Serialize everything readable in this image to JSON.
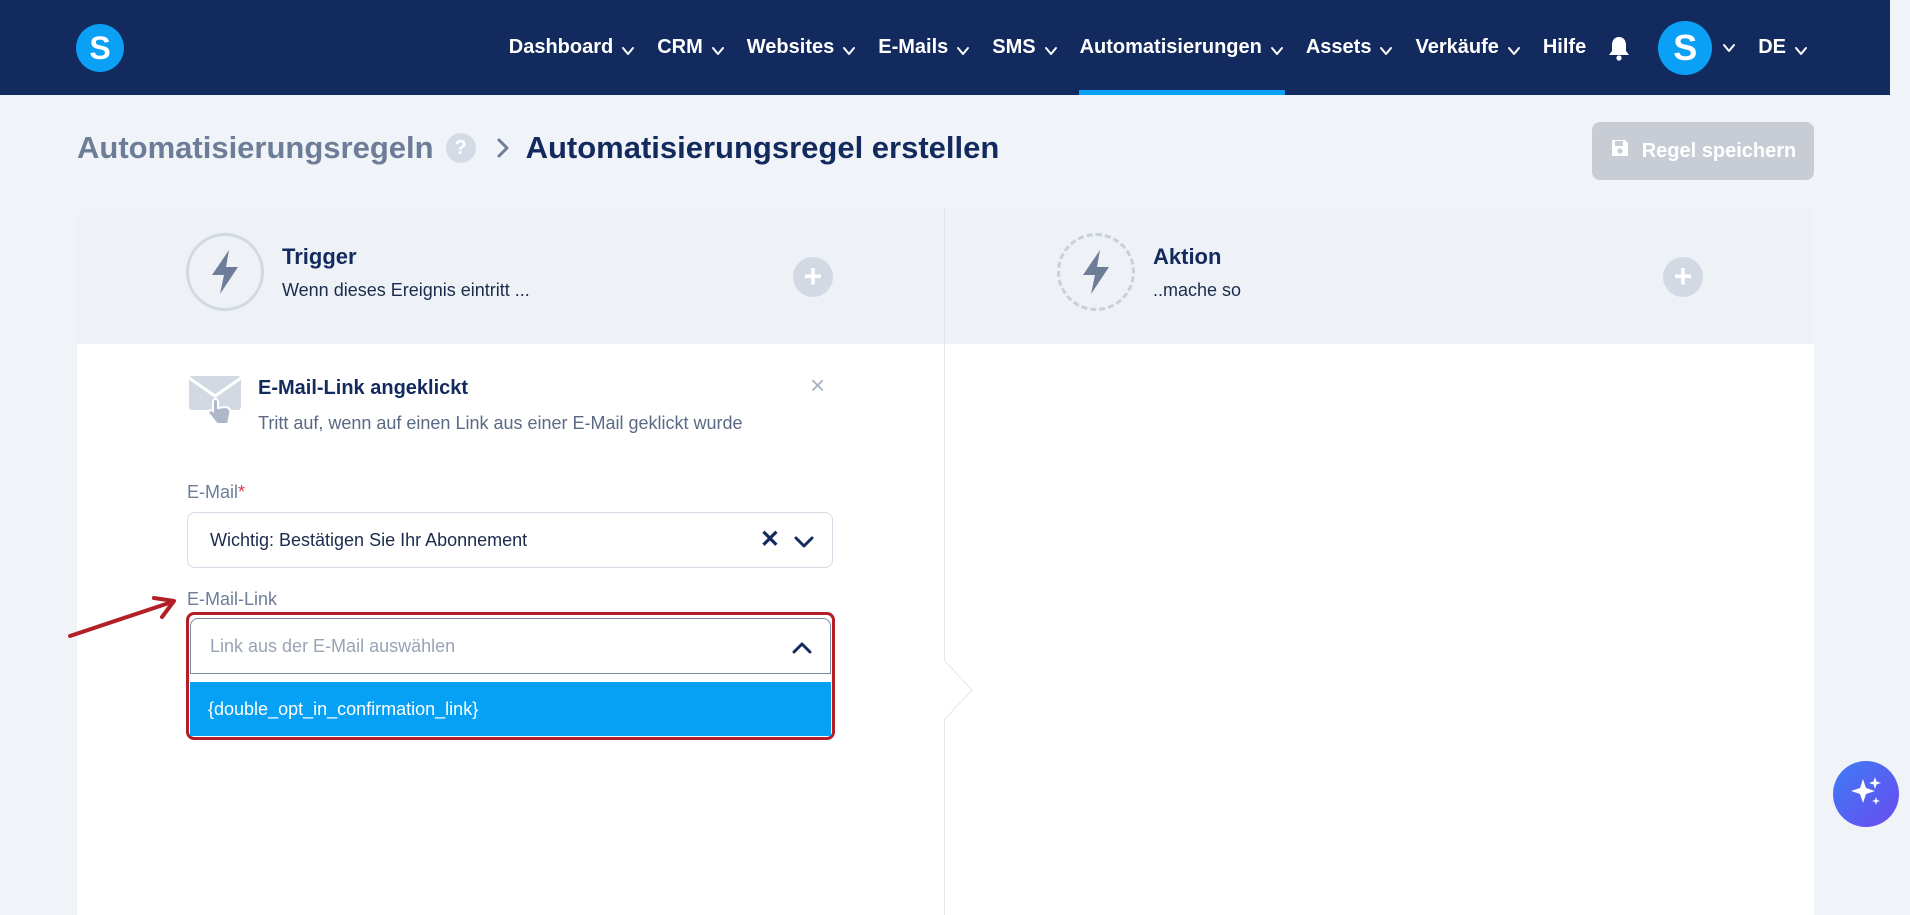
{
  "nav": {
    "logo": "S",
    "items": [
      {
        "label": "Dashboard",
        "dropdown": true,
        "active": false
      },
      {
        "label": "CRM",
        "dropdown": true,
        "active": false
      },
      {
        "label": "Websites",
        "dropdown": true,
        "active": false
      },
      {
        "label": "E-Mails",
        "dropdown": true,
        "active": false
      },
      {
        "label": "SMS",
        "dropdown": true,
        "active": false
      },
      {
        "label": "Automatisierungen",
        "dropdown": true,
        "active": true
      },
      {
        "label": "Assets",
        "dropdown": true,
        "active": false
      },
      {
        "label": "Verkäufe",
        "dropdown": true,
        "active": false
      },
      {
        "label": "Hilfe",
        "dropdown": false,
        "active": false
      }
    ],
    "avatar_letter": "S",
    "language": "DE"
  },
  "breadcrumb": {
    "root": "Automatisierungsregeln",
    "help": "?",
    "current": "Automatisierungsregel erstellen"
  },
  "save_button": {
    "label": "Regel speichern",
    "icon": "save-icon",
    "disabled": true
  },
  "trigger": {
    "title": "Trigger",
    "subtitle": "Wenn dieses Ereignis eintritt ..."
  },
  "action": {
    "title": "Aktion",
    "subtitle": "..mache so"
  },
  "trigger_card": {
    "title": "E-Mail-Link angeklickt",
    "description": "Tritt auf, wenn auf einen Link aus einer E-Mail geklickt wurde",
    "close": "×"
  },
  "email_field": {
    "label": "E-Mail",
    "required_mark": "*",
    "value": "Wichtig: Bestätigen Sie Ihr Abonnement"
  },
  "email_link_field": {
    "label": "E-Mail-Link",
    "placeholder": "Link aus der E-Mail auswählen",
    "options": [
      "{double_opt_in_confirmation_link}"
    ]
  },
  "colors": {
    "nav_bg": "#132a5e",
    "accent": "#0aa0f5",
    "highlight": "#b21f24"
  }
}
